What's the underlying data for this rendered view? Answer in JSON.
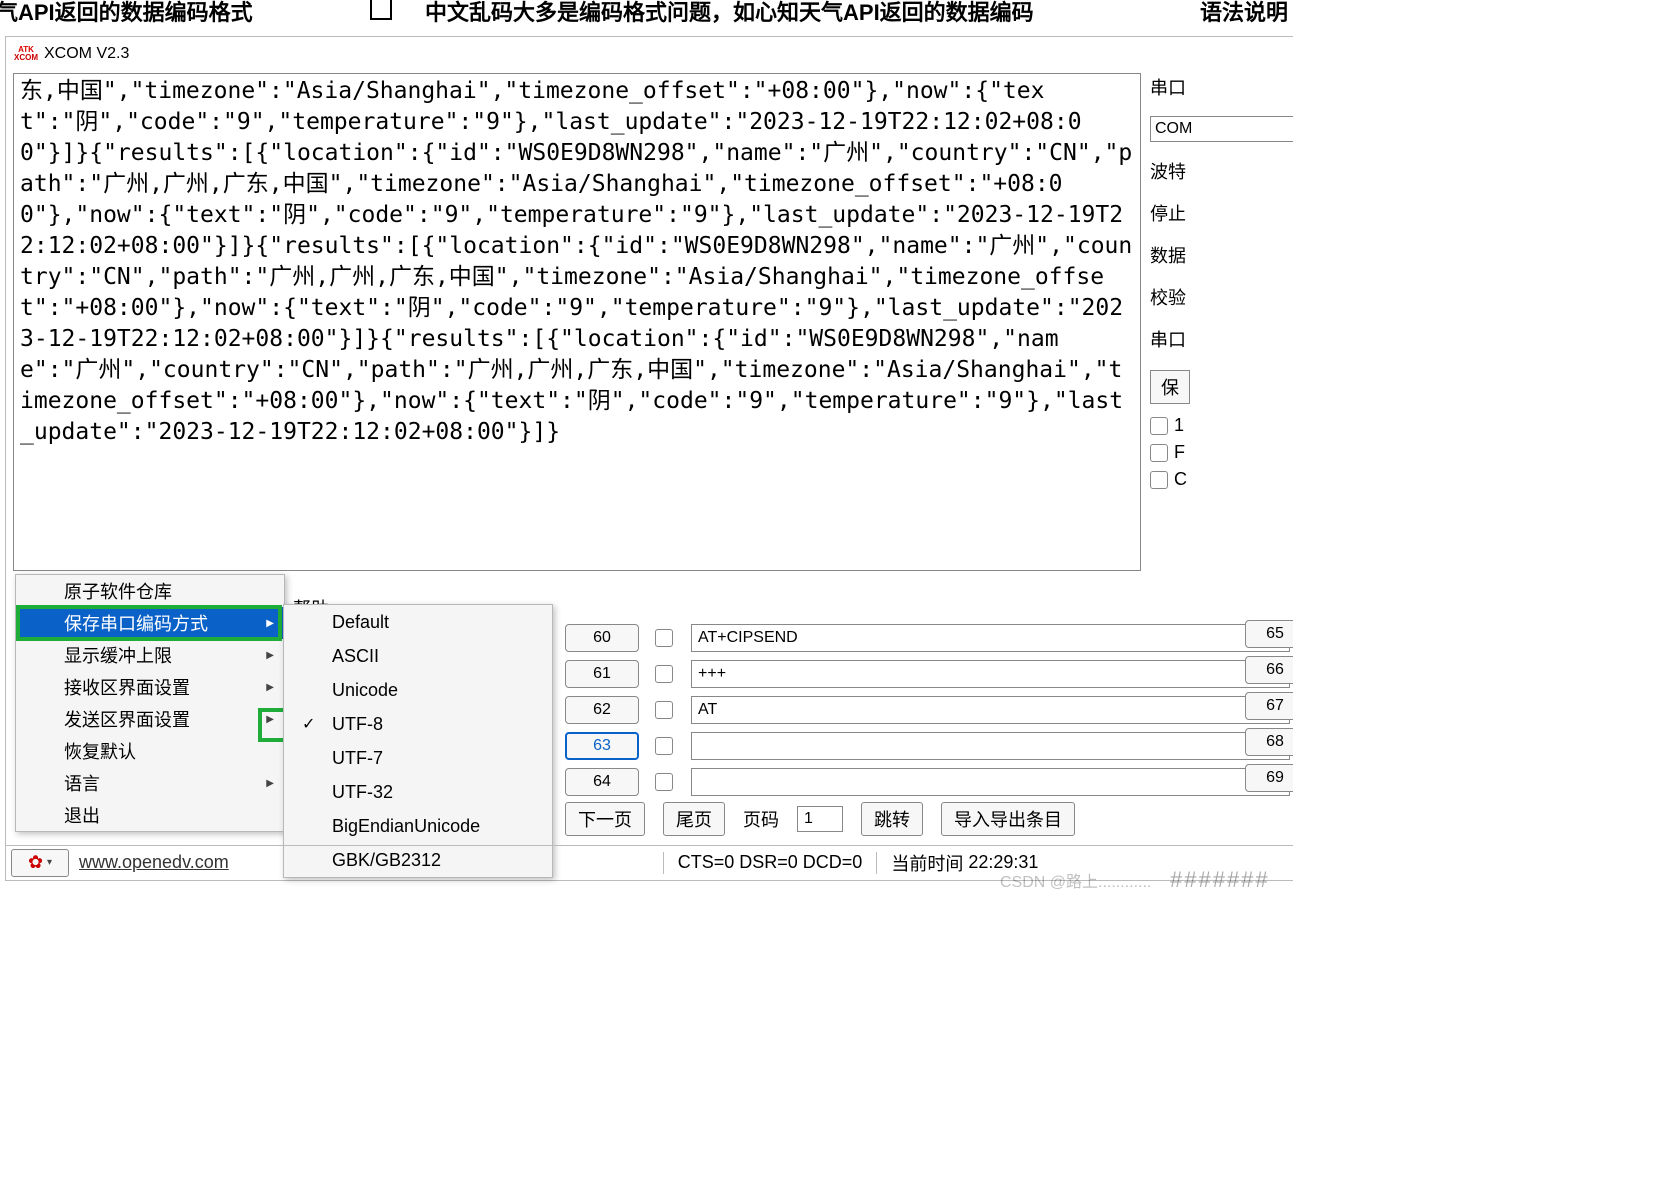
{
  "top": {
    "frag1": "心知天气API返回的数据编码格式",
    "frag2": "中文乱码大多是编码格式问题，如心知天气API返回的数据编码",
    "frag3": "语法说明"
  },
  "window": {
    "title": "XCOM V2.3"
  },
  "receive_text": "东,中国\",\"timezone\":\"Asia/Shanghai\",\"timezone_offset\":\"+08:00\"},\"now\":{\"text\":\"阴\",\"code\":\"9\",\"temperature\":\"9\"},\"last_update\":\"2023-12-19T22:12:02+08:00\"}]}{\"results\":[{\"location\":{\"id\":\"WS0E9D8WN298\",\"name\":\"广州\",\"country\":\"CN\",\"path\":\"广州,广州,广东,中国\",\"timezone\":\"Asia/Shanghai\",\"timezone_offset\":\"+08:00\"},\"now\":{\"text\":\"阴\",\"code\":\"9\",\"temperature\":\"9\"},\"last_update\":\"2023-12-19T22:12:02+08:00\"}]}{\"results\":[{\"location\":{\"id\":\"WS0E9D8WN298\",\"name\":\"广州\",\"country\":\"CN\",\"path\":\"广州,广州,广东,中国\",\"timezone\":\"Asia/Shanghai\",\"timezone_offset\":\"+08:00\"},\"now\":{\"text\":\"阴\",\"code\":\"9\",\"temperature\":\"9\"},\"last_update\":\"2023-12-19T22:12:02+08:00\"}]}{\"results\":[{\"location\":{\"id\":\"WS0E9D8WN298\",\"name\":\"广州\",\"country\":\"CN\",\"path\":\"广州,广州,广东,中国\",\"timezone\":\"Asia/Shanghai\",\"timezone_offset\":\"+08:00\"},\"now\":{\"text\":\"阴\",\"code\":\"9\",\"temperature\":\"9\"},\"last_update\":\"2023-12-19T22:12:02+08:00\"}]}",
  "right_panel": {
    "port_label": "串口",
    "port_value": "COM",
    "baud_label": "波特",
    "stop_label": "停止",
    "data_label": "数据",
    "parity_label": "校验",
    "oper_label": "串口",
    "save_btn": "保",
    "chk1": "1",
    "chk2": "F",
    "chk3": "C"
  },
  "context_menu": {
    "items": [
      "原子软件仓库",
      "保存串口编码方式",
      "显示缓冲上限",
      "接收区界面设置",
      "发送区界面设置",
      "恢复默认",
      "语言",
      "退出"
    ],
    "selected_index": 1
  },
  "sub_menu": {
    "items": [
      "Default",
      "ASCII",
      "Unicode",
      "UTF-8",
      "UTF-7",
      "UTF-32",
      "BigEndianUnicode",
      "GBK/GB2312"
    ],
    "checked_index": 3
  },
  "help_tab": "帮助",
  "send_rows": [
    {
      "n": "60",
      "cmd": "AT+CIPSEND",
      "r": "65"
    },
    {
      "n": "61",
      "cmd": "+++",
      "r": "66"
    },
    {
      "n": "62",
      "cmd": "AT",
      "r": "67"
    },
    {
      "n": "63",
      "cmd": "",
      "r": "68",
      "active": true
    },
    {
      "n": "64",
      "cmd": "",
      "r": "69"
    }
  ],
  "pager": {
    "next": "下一页",
    "last": "尾页",
    "page_label": "页码",
    "page_value": "1",
    "jump": "跳转",
    "import_export": "导入导出条目"
  },
  "status": {
    "link": "www.openedv.com",
    "signals": "CTS=0 DSR=0 DCD=0",
    "time_label": "当前时间",
    "time_value": "22:29:31"
  },
  "watermark": "CSDN @路上............",
  "hash": "#######"
}
